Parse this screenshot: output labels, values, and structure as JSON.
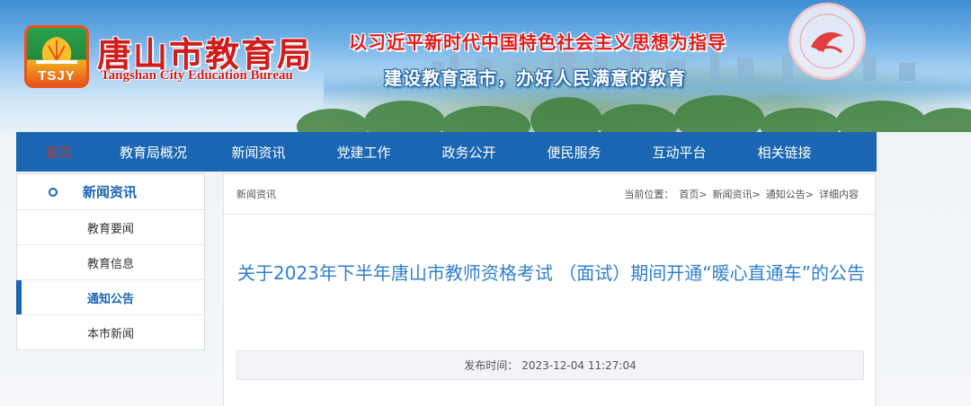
{
  "header": {
    "logo_text": "TSJY",
    "title": "唐山市教育局",
    "subtitle": "Tangshan City Education Bureau",
    "slogan_line1": "以习近平新时代中国特色社会主义思想为指导",
    "slogan_line2": "建设教育强市，办好人民满意的教育"
  },
  "nav": {
    "items": [
      {
        "label": "首页"
      },
      {
        "label": "教育局概况"
      },
      {
        "label": "新闻资讯"
      },
      {
        "label": "党建工作"
      },
      {
        "label": "政务公开"
      },
      {
        "label": "便民服务"
      },
      {
        "label": "互动平台"
      },
      {
        "label": "相关链接"
      }
    ]
  },
  "sidebar": {
    "heading": "新闻资讯",
    "items": [
      {
        "label": "教育要闻"
      },
      {
        "label": "教育信息"
      },
      {
        "label": "通知公告",
        "active": true
      },
      {
        "label": "本市新闻"
      }
    ]
  },
  "content": {
    "section_label": "新闻资讯",
    "breadcrumb": {
      "prefix": "当前位置：",
      "items": [
        "首页>",
        "新闻资讯>",
        "通知公告>",
        "详细内容"
      ]
    },
    "article_title": "关于2023年下半年唐山市教师资格考试 （面试）期间开通“暖心直通车”的公告",
    "meta_label": "发布时间：",
    "meta_value": "2023-12-04 11:27:04"
  },
  "colors": {
    "nav_bg": "#1a66b3",
    "title_red": "#d21c1c",
    "article_blue": "#2e7fd1"
  }
}
